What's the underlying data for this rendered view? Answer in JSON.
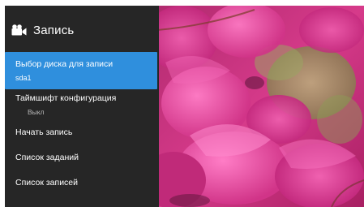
{
  "panel": {
    "title": "Запись",
    "title_icon": "video-camera-icon",
    "items": [
      {
        "label": "Выбор диска для записи",
        "value": "sda1",
        "selected": true
      },
      {
        "label": "Таймшифт конфигурация",
        "value": "Выкл",
        "selected": false
      },
      {
        "label": "Начать запись",
        "selected": false
      },
      {
        "label": "Список заданий",
        "selected": false
      },
      {
        "label": "Список записей",
        "selected": false
      }
    ]
  },
  "colors": {
    "panel_background": "#262626",
    "selection": "#2f8fdd",
    "text": "#ffffff",
    "secondary_text": "#b9b9b9"
  }
}
